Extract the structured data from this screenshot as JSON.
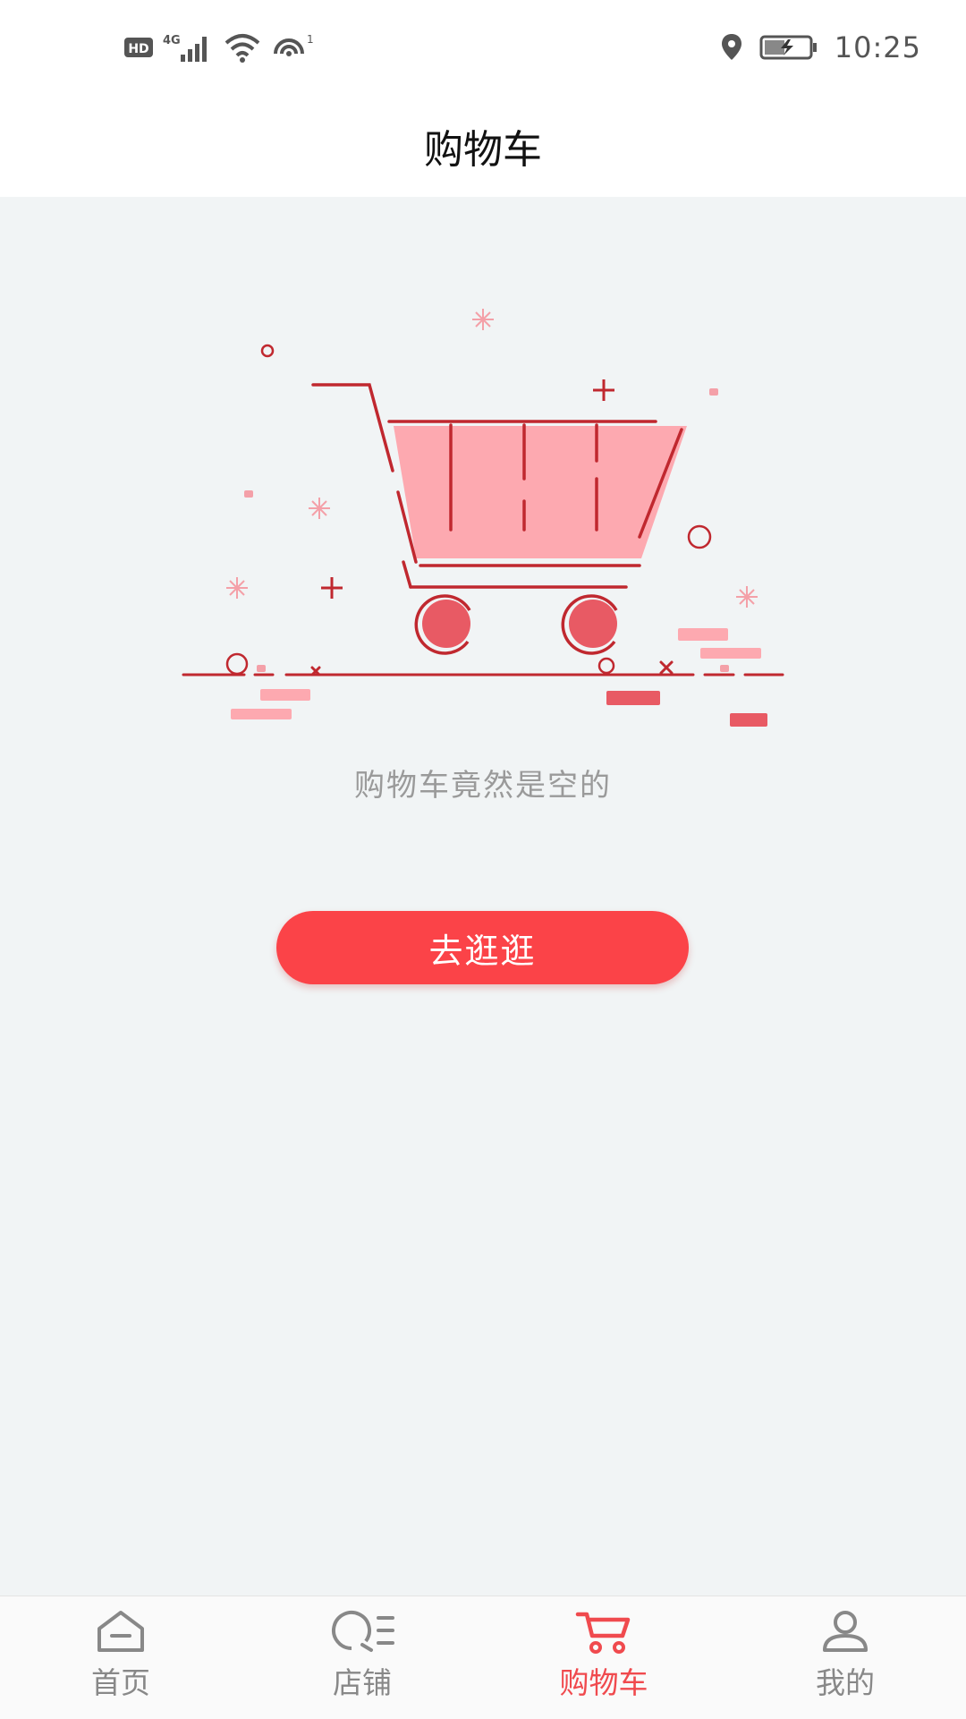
{
  "status_bar": {
    "time": "10:25",
    "network": "4G",
    "hd_badge": "HD",
    "hotspot_count": "1",
    "icons": [
      "hd-icon",
      "signal-4g-icon",
      "wifi-icon",
      "hotspot-icon",
      "location-icon",
      "battery-charging-icon"
    ]
  },
  "header": {
    "title": "购物车"
  },
  "empty_state": {
    "illustration": "empty-cart-illustration",
    "message": "购物车竟然是空的",
    "button_label": "去逛逛"
  },
  "tabbar": {
    "active_color": "#f04a4e",
    "inactive_color": "#888888",
    "items": [
      {
        "label": "首页",
        "icon": "home-icon",
        "active": false
      },
      {
        "label": "店铺",
        "icon": "store-list-icon",
        "active": false
      },
      {
        "label": "购物车",
        "icon": "cart-icon",
        "active": true
      },
      {
        "label": "我的",
        "icon": "user-icon",
        "active": false
      }
    ]
  },
  "colors": {
    "accent": "#fb4348",
    "background": "#f1f4f5"
  }
}
